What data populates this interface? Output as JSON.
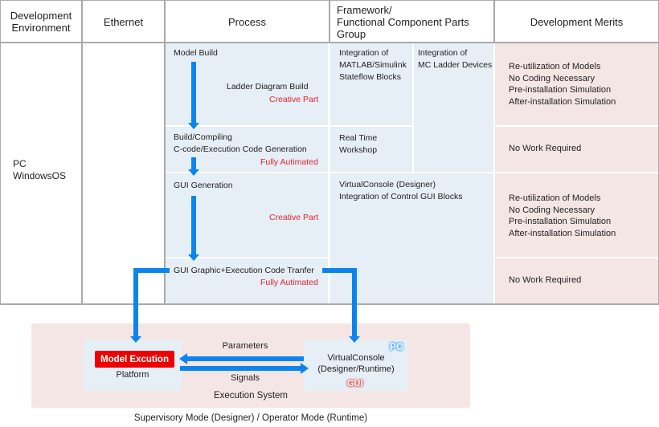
{
  "header": {
    "dev_env": "Development\nEnvironment",
    "ethernet": "Ethernet",
    "process": "Process",
    "framework_line1": "Framework/",
    "framework_line2": "Functional Component Parts Group",
    "merits": "Development Merits"
  },
  "environment": {
    "line1": "PC",
    "line2": "WindowsOS"
  },
  "process": {
    "step1": {
      "title": "Model Build",
      "sub": "Ladder Diagram Build",
      "tag": "Creative Part"
    },
    "step2": {
      "line1": "Build/Compiling",
      "line2": "C-code/Execution Code Generation",
      "tag": "Fully Autimated"
    },
    "step3": {
      "title": "GUI Generation",
      "tag": "Creative Part"
    },
    "step4": {
      "title": "GUI Graphic+Execution Code Tranfer",
      "tag": "Fully Autimated"
    }
  },
  "framework": {
    "matlab": [
      "Integration of",
      "MATLAB/Simulink",
      "Stateflow Blocks"
    ],
    "mc_ladder": [
      "Integration of",
      "MC Ladder Devices"
    ],
    "rtw": [
      "Real Time",
      "Workshop"
    ],
    "virtualconsole": [
      "VirtualConsole (Designer)",
      "Integration of Control GUI Blocks"
    ]
  },
  "merits": {
    "row1": [
      "Re-utilization of Models",
      "No Coding Necessary",
      "Pre-installation Simulation",
      "After-installation Simulation"
    ],
    "row2": "No Work Required",
    "row3": [
      "Re-utilization of Models",
      "No Coding Necessary",
      "Pre-installation Simulation",
      "After-installation Simulation"
    ],
    "row4": "No Work Required"
  },
  "execution": {
    "model_button": "Model Excution",
    "platform": "Platform",
    "parameters": "Parameters",
    "signals": "Signals",
    "vc_line1": "VirtualConsole",
    "vc_line2": "(Designer/Runtime)",
    "pc_badge": "PC",
    "gui_badge": "GUI",
    "system_label": "Execution System"
  },
  "footer": "Supervisory Mode (Designer) / Operator Mode (Runtime)",
  "colors": {
    "arrow": "#0a84f0",
    "accent_red": "#e8242a",
    "cell_blue": "#e6eef6",
    "cell_pink": "#f5e6e6"
  }
}
